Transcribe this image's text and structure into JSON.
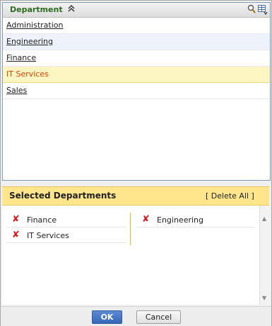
{
  "list": {
    "header": "Department",
    "rows": [
      "Administration",
      "Engineering",
      "Finance",
      "IT Services",
      "Sales"
    ],
    "selected_row": "IT Services"
  },
  "selected": {
    "title": "Selected Departments",
    "delete_all": "[ Delete All ]",
    "left_items": [
      "Finance",
      "IT Services"
    ],
    "right_items": [
      "Engineering"
    ]
  },
  "buttons": {
    "ok": "OK",
    "cancel": "Cancel"
  },
  "icons": {
    "sort": "double-chevron-up-icon",
    "search": "search-icon",
    "columns": "column-chooser-icon",
    "remove": "remove-x-icon"
  },
  "colors": {
    "header_title": "#2e6b1f",
    "selected_row_text": "#d04300",
    "selected_row_bg": "#fdf6c3",
    "selected_panel_header_bg": "#ffe68c",
    "remove_icon": "#d61c1c",
    "ok_button": "#3766b8"
  }
}
